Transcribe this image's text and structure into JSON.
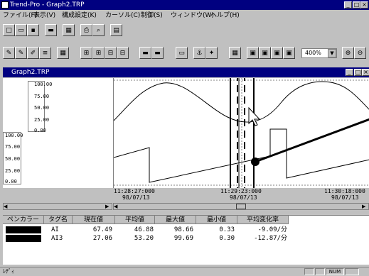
{
  "app": {
    "title": "Trend-Pro - Graph2.TRP"
  },
  "menu": [
    "ファイル(F)",
    "表示(V)",
    "構成設定(K)",
    "カーソル(C)",
    "制御(S)",
    "ウィンドウ(W)",
    "ヘルプ(H)"
  ],
  "toolbar": {
    "zoom_value": "400%"
  },
  "graph": {
    "title": "Graph2.TRP"
  },
  "scale1": {
    "ticks": [
      "100.00",
      "75.00",
      "50.00",
      "25.00",
      "0.00"
    ]
  },
  "scale2": {
    "ticks": [
      "100.00",
      "75.00",
      "50.00",
      "25.00",
      "0.00"
    ]
  },
  "times": [
    {
      "time": "11:28:27:000",
      "date": "98/07/13"
    },
    {
      "time": "11:29:23:000",
      "date": "98/07/13"
    },
    {
      "time": "11:30:18:000",
      "date": "98/07/13"
    }
  ],
  "table": {
    "headers": [
      "ペンカラー",
      "タグ名",
      "現在値",
      "平均値",
      "最大値",
      "最小値",
      "平均変化率"
    ],
    "rows": [
      {
        "color": "#000000",
        "tag": "AI",
        "current": "67.49",
        "avg": "46.88",
        "max": "98.66",
        "min": "0.33",
        "rate": "-9.09/分"
      },
      {
        "color": "#000000",
        "tag": "AI3",
        "current": "27.06",
        "avg": "53.20",
        "max": "99.69",
        "min": "0.30",
        "rate": "-12.87/分"
      }
    ]
  },
  "status": {
    "text": "ﾚﾃﾞｨ",
    "num": "NUM"
  },
  "colors": {
    "titlebar": "#000080",
    "face": "#c0c0c0"
  }
}
